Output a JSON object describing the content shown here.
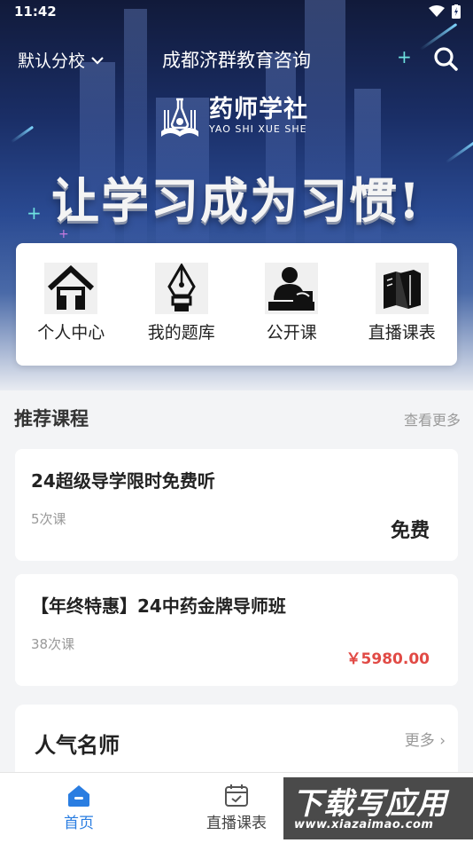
{
  "status_bar": {
    "time": "11:42"
  },
  "header": {
    "campus_label": "默认分校",
    "org_name": "成都济群教育咨询"
  },
  "banner": {
    "brand_cn": "药师学社",
    "brand_en": "YAO SHI XUE SHE",
    "slogan": "让学习成为习惯!"
  },
  "quick_nav": [
    {
      "label": "个人中心",
      "icon": "home-icon"
    },
    {
      "label": "我的题库",
      "icon": "pen-nib-icon"
    },
    {
      "label": "公开课",
      "icon": "lecturer-icon"
    },
    {
      "label": "直播课表",
      "icon": "books-icon"
    }
  ],
  "recommended": {
    "title": "推荐课程",
    "more": "查看更多",
    "courses": [
      {
        "title": "24超级导学限时免费听",
        "lessons": "5次课",
        "price": "免费"
      },
      {
        "title": "【年终特惠】24中药金牌导师班",
        "lessons": "38次课",
        "price": "￥5980.00"
      }
    ]
  },
  "teachers": {
    "title": "人气名师",
    "more": "更多 ›"
  },
  "tabbar": [
    {
      "label": "首页",
      "active": true
    },
    {
      "label": "直播课表",
      "active": false
    }
  ],
  "watermark": {
    "line1": "下载写应用",
    "line2": "www.xiazaimao.com"
  },
  "colors": {
    "accent": "#2a7de1",
    "price_red": "#e14a45"
  }
}
